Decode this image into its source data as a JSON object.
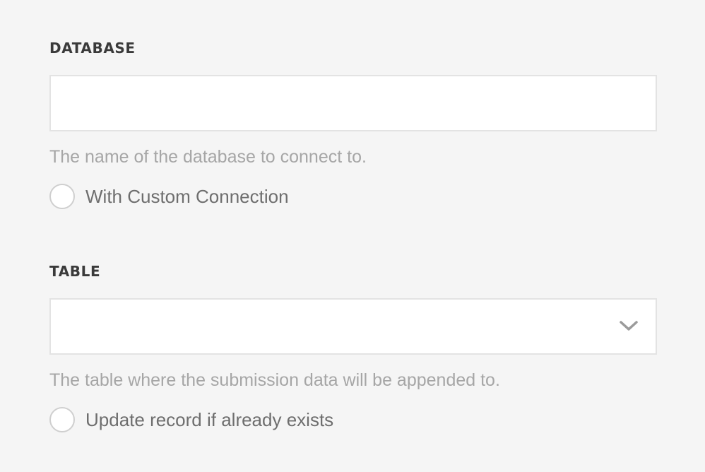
{
  "database": {
    "label": "DATABASE",
    "value": "",
    "placeholder": "",
    "help": "The name of the database to connect to.",
    "custom_connection_label": "With Custom Connection"
  },
  "table": {
    "label": "TABLE",
    "selected": "",
    "help": "The table where the submission data will be appended to.",
    "update_record_label": "Update record if already exists"
  },
  "icons": {
    "select_arrow": "chevron-down-icon"
  }
}
